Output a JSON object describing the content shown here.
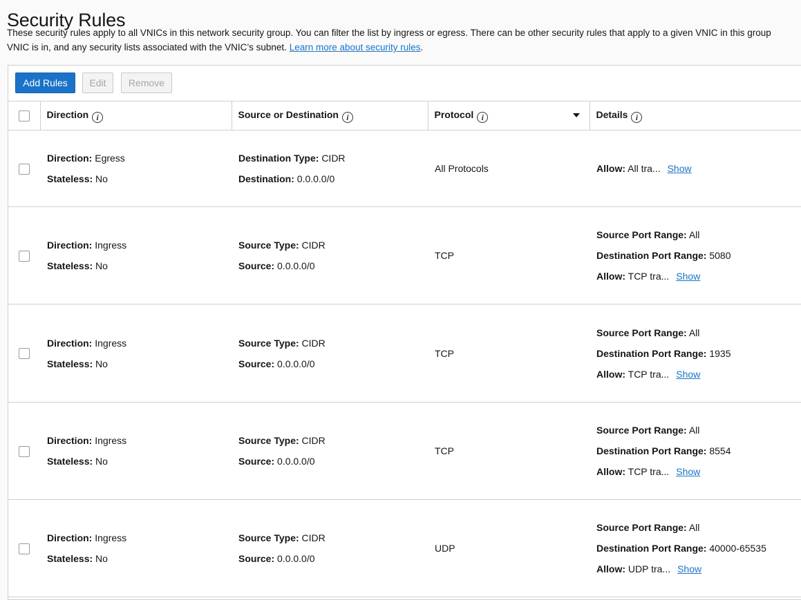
{
  "page": {
    "title": "Security Rules",
    "description_line1": "These security rules apply to all VNICs in this network security group. You can filter the list by ingress or egress. There can be other security rules that apply to a given VNIC in this group",
    "description_line2": "VNIC is in, and any security lists associated with the VNIC’s subnet.",
    "learn_more_link": "Learn more about security rules",
    "description_end": "."
  },
  "toolbar": {
    "add_label": "Add Rules",
    "edit_label": "Edit",
    "remove_label": "Remove"
  },
  "columns": {
    "direction": "Direction",
    "source_dest": "Source or Destination",
    "protocol": "Protocol",
    "details": "Details"
  },
  "labels": {
    "direction": "Direction:",
    "stateless": "Stateless:",
    "source_type": "Source Type:",
    "source": "Source:",
    "destination_type": "Destination Type:",
    "destination": "Destination:",
    "source_port_range": "Source Port Range:",
    "destination_port_range": "Destination Port Range:",
    "allow": "Allow:",
    "show": "Show"
  },
  "rows": [
    {
      "direction": "Egress",
      "stateless": "No",
      "type_label": "Destination Type:",
      "type_value": "CIDR",
      "addr_label": "Destination:",
      "addr_value": "0.0.0.0/0",
      "protocol": "All Protocols",
      "source_port_range": "",
      "destination_port_range": "",
      "allow": "All tra..."
    },
    {
      "direction": "Ingress",
      "stateless": "No",
      "type_label": "Source Type:",
      "type_value": "CIDR",
      "addr_label": "Source:",
      "addr_value": "0.0.0.0/0",
      "protocol": "TCP",
      "source_port_range": "All",
      "destination_port_range": "5080",
      "allow": "TCP tra..."
    },
    {
      "direction": "Ingress",
      "stateless": "No",
      "type_label": "Source Type:",
      "type_value": "CIDR",
      "addr_label": "Source:",
      "addr_value": "0.0.0.0/0",
      "protocol": "TCP",
      "source_port_range": "All",
      "destination_port_range": "1935",
      "allow": "TCP tra..."
    },
    {
      "direction": "Ingress",
      "stateless": "No",
      "type_label": "Source Type:",
      "type_value": "CIDR",
      "addr_label": "Source:",
      "addr_value": "0.0.0.0/0",
      "protocol": "TCP",
      "source_port_range": "All",
      "destination_port_range": "8554",
      "allow": "TCP tra..."
    },
    {
      "direction": "Ingress",
      "stateless": "No",
      "type_label": "Source Type:",
      "type_value": "CIDR",
      "addr_label": "Source:",
      "addr_value": "0.0.0.0/0",
      "protocol": "UDP",
      "source_port_range": "All",
      "destination_port_range": "40000-65535",
      "allow": "UDP tra..."
    }
  ],
  "icons": {
    "info": "info-icon",
    "sort": "caret-down-icon"
  },
  "colors": {
    "accent": "#1a73c8",
    "border": "#cfcfcf",
    "background": "#fafafa"
  }
}
